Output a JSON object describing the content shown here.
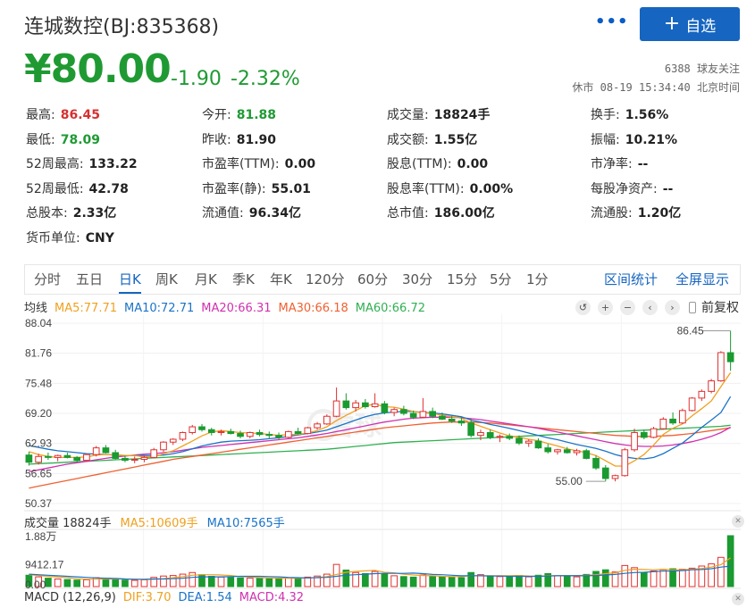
{
  "header": {
    "title": "连城数控(BJ:835368)",
    "more": "•••",
    "add_label": "自选"
  },
  "quote": {
    "price": "¥80.00",
    "change": "-1.90",
    "change_pct": "-2.32%",
    "followers": "6388 球友关注",
    "status": "休市 08-19 15:34:40 北京时间"
  },
  "stats": [
    [
      {
        "label": "最高:",
        "value": "86.45",
        "color": "red"
      },
      {
        "label": "今开:",
        "value": "81.88",
        "color": "green"
      },
      {
        "label": "成交量:",
        "value": "18824手",
        "color": ""
      },
      {
        "label": "换手:",
        "value": "1.56%",
        "color": ""
      }
    ],
    [
      {
        "label": "最低:",
        "value": "78.09",
        "color": "green"
      },
      {
        "label": "昨收:",
        "value": "81.90",
        "color": ""
      },
      {
        "label": "成交额:",
        "value": "1.55亿",
        "color": ""
      },
      {
        "label": "振幅:",
        "value": "10.21%",
        "color": ""
      }
    ],
    [
      {
        "label": "52周最高:",
        "value": "133.22",
        "color": ""
      },
      {
        "label": "市盈率(TTM):",
        "value": "0.00",
        "color": ""
      },
      {
        "label": "股息(TTM):",
        "value": "0.00",
        "color": ""
      },
      {
        "label": "市净率:",
        "value": "--",
        "color": ""
      }
    ],
    [
      {
        "label": "52周最低:",
        "value": "42.78",
        "color": ""
      },
      {
        "label": "市盈率(静):",
        "value": "55.01",
        "color": ""
      },
      {
        "label": "股息率(TTM):",
        "value": "0.00%",
        "color": ""
      },
      {
        "label": "每股净资产:",
        "value": "--",
        "color": ""
      }
    ],
    [
      {
        "label": "总股本:",
        "value": "2.33亿",
        "color": ""
      },
      {
        "label": "流通值:",
        "value": "96.34亿",
        "color": ""
      },
      {
        "label": "总市值:",
        "value": "186.00亿",
        "color": ""
      },
      {
        "label": "流通股:",
        "value": "1.20亿",
        "color": ""
      }
    ],
    [
      {
        "label": "货币单位:",
        "value": "CNY",
        "color": ""
      }
    ]
  ],
  "tabs": [
    "分时",
    "五日",
    "日K",
    "周K",
    "月K",
    "季K",
    "年K",
    "120分",
    "60分",
    "30分",
    "15分",
    "5分",
    "1分"
  ],
  "active_tab": "日K",
  "tab_actions": [
    "区间统计",
    "全屏显示"
  ],
  "ma_legend": {
    "label": "均线",
    "items": [
      {
        "text": "MA5:77.71",
        "color": "#f0a020"
      },
      {
        "text": "MA10:72.71",
        "color": "#1a73c8"
      },
      {
        "text": "MA20:66.31",
        "color": "#d030b0"
      },
      {
        "text": "MA30:66.18",
        "color": "#f06030"
      },
      {
        "text": "MA60:66.72",
        "color": "#30b050"
      }
    ]
  },
  "toolbar": {
    "undo": "↺",
    "zoom_in": "+",
    "zoom_out": "−",
    "prev": "‹",
    "next": "›",
    "adjust": "前复权"
  },
  "colors": {
    "up": "#e03030",
    "down": "#1a9a30",
    "accent": "#1665c0"
  },
  "volume_legend": {
    "items": [
      {
        "text": "成交量 18824手",
        "color": "#333333"
      },
      {
        "text": "MA5:10609手",
        "color": "#f0a020"
      },
      {
        "text": "MA10:7565手",
        "color": "#1a73c8"
      }
    ]
  },
  "macd_legend": {
    "items": [
      {
        "text": "MACD (12,26,9)",
        "color": "#333333"
      },
      {
        "text": "DIF:3.70",
        "color": "#f0a020"
      },
      {
        "text": "DEA:1.54",
        "color": "#1a73c8"
      },
      {
        "text": "MACD:4.32",
        "color": "#d030b0"
      }
    ]
  },
  "watermark": "雪球",
  "chart_data": {
    "type": "candlestick",
    "y_ticks": [
      "88.04",
      "81.76",
      "75.48",
      "69.20",
      "62.93",
      "56.65",
      "50.37"
    ],
    "ylim": [
      50.37,
      88.04
    ],
    "high_label": "86.45",
    "low_label": "55.00",
    "high_value": 86.45,
    "low_value": 55.0,
    "candles": [
      [
        60.5,
        61.2,
        58.3,
        59.0
      ],
      [
        59.0,
        60.8,
        58.5,
        60.2
      ],
      [
        60.2,
        61.0,
        59.5,
        60.0
      ],
      [
        60.0,
        60.6,
        59.2,
        60.4
      ],
      [
        60.4,
        61.0,
        59.8,
        60.0
      ],
      [
        60.0,
        60.3,
        59.0,
        59.4
      ],
      [
        59.4,
        60.8,
        59.2,
        60.6
      ],
      [
        60.6,
        62.4,
        60.2,
        62.0
      ],
      [
        62.0,
        62.6,
        60.8,
        61.0
      ],
      [
        61.0,
        61.6,
        59.6,
        59.8
      ],
      [
        59.8,
        60.4,
        59.0,
        59.4
      ],
      [
        59.4,
        60.2,
        58.8,
        59.6
      ],
      [
        59.6,
        60.4,
        59.0,
        60.0
      ],
      [
        60.0,
        62.0,
        59.8,
        61.6
      ],
      [
        61.6,
        63.4,
        61.2,
        63.2
      ],
      [
        63.2,
        64.0,
        62.6,
        63.8
      ],
      [
        63.8,
        65.4,
        63.4,
        65.2
      ],
      [
        65.2,
        66.8,
        64.8,
        66.4
      ],
      [
        66.4,
        67.0,
        65.4,
        65.8
      ],
      [
        65.8,
        66.2,
        64.6,
        65.2
      ],
      [
        65.2,
        65.8,
        64.6,
        65.4
      ],
      [
        65.4,
        66.0,
        64.8,
        65.0
      ],
      [
        65.0,
        65.6,
        64.0,
        64.4
      ],
      [
        64.4,
        65.4,
        64.0,
        65.2
      ],
      [
        65.2,
        65.8,
        64.4,
        64.8
      ],
      [
        64.8,
        65.4,
        64.0,
        64.6
      ],
      [
        64.6,
        65.2,
        63.8,
        64.2
      ],
      [
        64.2,
        65.6,
        64.0,
        65.4
      ],
      [
        65.4,
        66.2,
        64.8,
        65.0
      ],
      [
        65.0,
        66.4,
        64.8,
        66.2
      ],
      [
        66.2,
        67.4,
        65.8,
        67.0
      ],
      [
        67.0,
        69.0,
        66.8,
        68.6
      ],
      [
        68.6,
        74.6,
        68.4,
        71.8
      ],
      [
        71.8,
        73.4,
        70.0,
        70.4
      ],
      [
        70.4,
        72.0,
        69.6,
        71.4
      ],
      [
        71.4,
        72.2,
        70.2,
        70.6
      ],
      [
        70.6,
        73.4,
        70.4,
        71.2
      ],
      [
        71.2,
        71.8,
        69.0,
        69.4
      ],
      [
        69.4,
        70.4,
        68.6,
        70.0
      ],
      [
        70.0,
        70.8,
        68.8,
        69.2
      ],
      [
        69.2,
        69.8,
        68.0,
        68.4
      ],
      [
        68.4,
        72.4,
        68.2,
        69.6
      ],
      [
        69.6,
        70.4,
        68.2,
        68.6
      ],
      [
        68.6,
        69.4,
        67.8,
        68.0
      ],
      [
        68.0,
        68.8,
        67.2,
        67.6
      ],
      [
        67.6,
        68.4,
        66.6,
        67.2
      ],
      [
        67.2,
        68.0,
        64.2,
        64.6
      ],
      [
        64.6,
        65.8,
        63.6,
        65.2
      ],
      [
        65.2,
        65.8,
        63.8,
        64.2
      ],
      [
        64.2,
        64.8,
        63.2,
        64.4
      ],
      [
        64.4,
        65.0,
        63.6,
        64.0
      ],
      [
        64.0,
        64.6,
        62.6,
        63.0
      ],
      [
        63.0,
        63.8,
        62.2,
        63.4
      ],
      [
        63.4,
        64.0,
        61.8,
        62.0
      ],
      [
        62.0,
        62.8,
        60.8,
        61.2
      ],
      [
        61.2,
        61.8,
        60.6,
        61.6
      ],
      [
        61.6,
        62.2,
        60.8,
        61.0
      ],
      [
        61.0,
        61.8,
        60.4,
        61.4
      ],
      [
        61.4,
        61.8,
        59.6,
        59.8
      ],
      [
        59.8,
        60.4,
        57.4,
        57.8
      ],
      [
        57.8,
        58.4,
        55.0,
        55.6
      ],
      [
        55.6,
        56.4,
        55.0,
        56.2
      ],
      [
        56.2,
        62.0,
        56.0,
        61.6
      ],
      [
        61.6,
        66.0,
        61.2,
        65.2
      ],
      [
        65.2,
        65.8,
        63.8,
        64.2
      ],
      [
        64.2,
        66.4,
        64.0,
        66.0
      ],
      [
        66.0,
        68.4,
        65.8,
        68.0
      ],
      [
        68.0,
        69.4,
        66.8,
        67.2
      ],
      [
        67.2,
        70.2,
        67.0,
        69.8
      ],
      [
        69.8,
        72.6,
        69.6,
        72.4
      ],
      [
        72.4,
        74.2,
        71.8,
        73.8
      ],
      [
        73.8,
        76.4,
        73.4,
        76.0
      ],
      [
        76.0,
        82.2,
        75.8,
        81.9
      ],
      [
        81.88,
        86.45,
        78.09,
        80.0
      ]
    ],
    "ma5": [
      61.2,
      60.6,
      60.2,
      60.0,
      60.0,
      60.0,
      60.1,
      60.5,
      60.6,
      60.5,
      60.4,
      60.4,
      60.1,
      60.1,
      60.8,
      61.4,
      62.4,
      63.4,
      64.5,
      65.3,
      65.6,
      65.4,
      65.2,
      65.1,
      65.0,
      64.8,
      64.6,
      64.8,
      64.8,
      65.1,
      65.6,
      66.4,
      67.7,
      68.8,
      69.8,
      70.8,
      71.1,
      70.6,
      70.5,
      70.1,
      69.6,
      69.3,
      69.2,
      68.8,
      68.5,
      68.2,
      67.2,
      66.5,
      65.8,
      65.1,
      64.5,
      64.2,
      63.8,
      63.5,
      62.9,
      62.4,
      61.8,
      61.4,
      61.0,
      60.4,
      59.3,
      58.2,
      58.2,
      59.3,
      60.6,
      62.6,
      64.8,
      66.1,
      67.0,
      68.7,
      70.2,
      71.8,
      74.8,
      77.71
    ],
    "ma10": [
      62.5,
      62.1,
      61.7,
      61.4,
      61.2,
      61.0,
      60.8,
      60.7,
      60.6,
      60.5,
      60.4,
      60.4,
      60.4,
      60.4,
      60.5,
      60.8,
      61.2,
      61.8,
      62.4,
      62.8,
      63.2,
      63.4,
      63.5,
      63.6,
      63.7,
      63.9,
      64.1,
      64.4,
      64.7,
      65.0,
      65.3,
      65.7,
      66.4,
      67.1,
      67.8,
      68.5,
      69.0,
      69.3,
      69.5,
      69.6,
      69.6,
      69.4,
      69.3,
      69.1,
      68.8,
      68.5,
      67.8,
      67.4,
      66.9,
      66.5,
      66.1,
      65.6,
      65.1,
      64.6,
      64.1,
      63.7,
      63.2,
      62.7,
      62.3,
      61.9,
      61.3,
      60.6,
      60.1,
      59.8,
      59.7,
      60.0,
      60.8,
      61.9,
      63.0,
      64.6,
      66.3,
      67.8,
      69.4,
      72.71
    ],
    "ma20": [
      57.0,
      57.4,
      57.8,
      58.2,
      58.6,
      58.9,
      59.2,
      59.5,
      59.8,
      60.1,
      60.3,
      60.5,
      60.7,
      60.8,
      61.0,
      61.2,
      61.5,
      61.8,
      62.1,
      62.3,
      62.5,
      62.7,
      62.9,
      63.1,
      63.3,
      63.5,
      63.7,
      63.9,
      64.1,
      64.4,
      64.7,
      65.0,
      65.4,
      65.8,
      66.2,
      66.6,
      67.0,
      67.4,
      67.7,
      68.0,
      68.2,
      68.3,
      68.4,
      68.4,
      68.4,
      68.3,
      68.1,
      67.9,
      67.6,
      67.3,
      67.0,
      66.7,
      66.4,
      66.1,
      65.7,
      65.3,
      64.9,
      64.5,
      64.1,
      63.7,
      63.3,
      62.9,
      62.6,
      62.4,
      62.3,
      62.3,
      62.4,
      62.6,
      62.9,
      63.3,
      63.8,
      64.4,
      65.2,
      66.31
    ],
    "ma30": [
      53.6,
      54.0,
      54.4,
      54.8,
      55.2,
      55.6,
      56.0,
      56.4,
      56.8,
      57.2,
      57.6,
      58.0,
      58.4,
      58.8,
      59.2,
      59.6,
      59.9,
      60.2,
      60.5,
      60.8,
      61.1,
      61.4,
      61.7,
      62.0,
      62.3,
      62.6,
      62.9,
      63.2,
      63.5,
      63.8,
      64.1,
      64.4,
      64.7,
      65.0,
      65.3,
      65.6,
      65.9,
      66.2,
      66.4,
      66.6,
      66.8,
      67.0,
      67.2,
      67.3,
      67.4,
      67.4,
      67.4,
      67.3,
      67.2,
      67.0,
      66.8,
      66.6,
      66.4,
      66.2,
      66.0,
      65.8,
      65.6,
      65.4,
      65.2,
      65.0,
      64.8,
      64.6,
      64.5,
      64.4,
      64.4,
      64.4,
      64.5,
      64.6,
      64.8,
      65.0,
      65.3,
      65.6,
      65.9,
      66.18
    ],
    "ma60": [
      58.6,
      58.7,
      58.8,
      58.9,
      59.0,
      59.1,
      59.2,
      59.3,
      59.4,
      59.5,
      59.6,
      59.7,
      59.8,
      59.9,
      60.0,
      60.1,
      60.2,
      60.3,
      60.4,
      60.5,
      60.6,
      60.7,
      60.8,
      60.9,
      61.0,
      61.1,
      61.2,
      61.3,
      61.4,
      61.5,
      61.6,
      61.7,
      61.9,
      62.1,
      62.3,
      62.5,
      62.7,
      62.9,
      63.1,
      63.2,
      63.3,
      63.4,
      63.5,
      63.6,
      63.7,
      63.8,
      63.9,
      64.0,
      64.1,
      64.2,
      64.3,
      64.4,
      64.5,
      64.6,
      64.7,
      64.8,
      64.9,
      65.0,
      65.1,
      65.2,
      65.3,
      65.4,
      65.5,
      65.6,
      65.7,
      65.8,
      65.9,
      66.0,
      66.1,
      66.2,
      66.3,
      66.4,
      66.5,
      66.72
    ],
    "volume_y_ticks": [
      "1.88万",
      "9412.17",
      "0.00"
    ],
    "volume_ylim": [
      0,
      18824
    ],
    "volumes": [
      4200,
      3600,
      3100,
      2800,
      2600,
      2400,
      2500,
      3300,
      3000,
      2700,
      2400,
      2300,
      2500,
      3400,
      3900,
      4100,
      4600,
      5200,
      4400,
      3800,
      3500,
      3400,
      3200,
      3100,
      3000,
      2900,
      3000,
      3300,
      3100,
      3500,
      3900,
      4600,
      8200,
      6100,
      5200,
      4800,
      5600,
      4700,
      4000,
      3700,
      3500,
      4300,
      3900,
      3600,
      3400,
      3300,
      5200,
      4400,
      4000,
      3700,
      3500,
      4100,
      3600,
      4200,
      4800,
      4000,
      3800,
      3600,
      4500,
      5600,
      6200,
      5400,
      7800,
      7000,
      5200,
      5800,
      6200,
      6600,
      6400,
      6800,
      7600,
      8400,
      10800,
      18824
    ],
    "volume_ma5": [
      4400,
      4100,
      3800,
      3500,
      3300,
      2900,
      2700,
      2700,
      2800,
      2800,
      2800,
      2700,
      2600,
      2700,
      2900,
      3300,
      3700,
      4200,
      4400,
      4400,
      4300,
      4100,
      3700,
      3500,
      3300,
      3200,
      3100,
      3100,
      3100,
      3200,
      3400,
      3700,
      4500,
      5300,
      5600,
      5800,
      6000,
      5300,
      5100,
      4600,
      4300,
      4100,
      4000,
      3800,
      3700,
      3700,
      4000,
      4000,
      4000,
      4000,
      4000,
      4100,
      3900,
      3800,
      4000,
      4100,
      4100,
      4100,
      4200,
      4400,
      4800,
      5100,
      6000,
      6400,
      6300,
      6200,
      6400,
      6200,
      6200,
      6400,
      6700,
      7200,
      8100,
      10609
    ],
    "volume_ma10": [
      4600,
      4400,
      4200,
      4000,
      3800,
      3600,
      3400,
      3200,
      3100,
      3000,
      2800,
      2700,
      2700,
      2800,
      2800,
      2900,
      3100,
      3400,
      3600,
      3600,
      3600,
      3700,
      3800,
      3800,
      3800,
      3700,
      3600,
      3400,
      3300,
      3200,
      3300,
      3400,
      3800,
      4200,
      4400,
      4600,
      4800,
      4900,
      4900,
      4900,
      5000,
      4800,
      4500,
      4400,
      4200,
      4000,
      4000,
      4000,
      3900,
      3900,
      3800,
      3800,
      3800,
      3800,
      3900,
      4000,
      4000,
      4000,
      4000,
      4100,
      4300,
      4500,
      4900,
      5200,
      5300,
      5500,
      5700,
      5700,
      5900,
      6200,
      6300,
      6600,
      7200,
      7565
    ]
  }
}
